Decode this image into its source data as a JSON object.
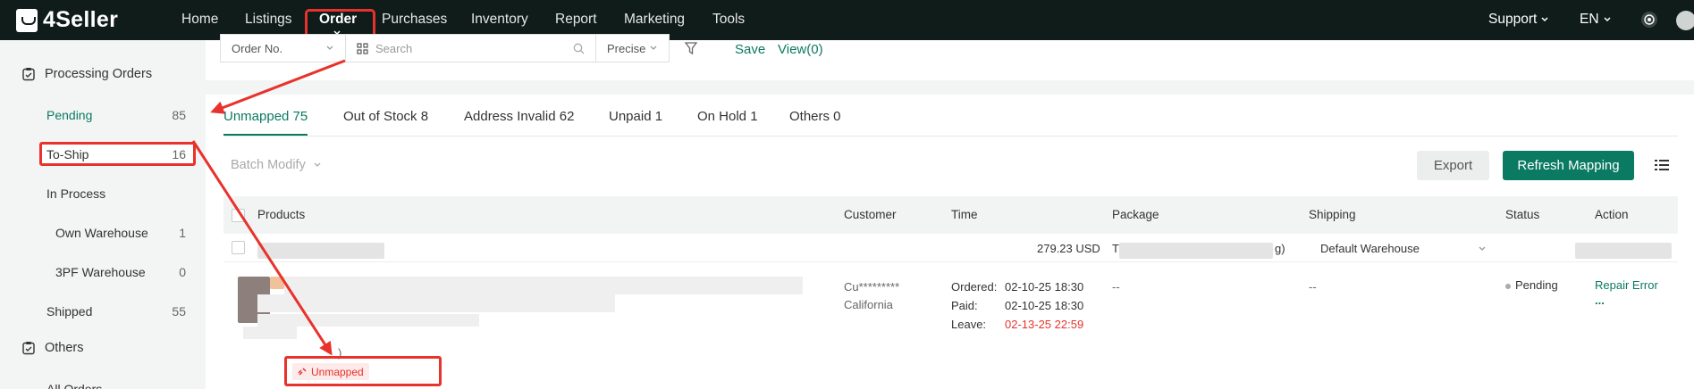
{
  "brand": {
    "name": "4Seller"
  },
  "nav": {
    "items": [
      "Home",
      "Listings",
      "Order",
      "Purchases",
      "Inventory",
      "Report",
      "Marketing",
      "Tools"
    ],
    "support": "Support",
    "language": "EN"
  },
  "sidebar": {
    "processing_orders": "Processing Orders",
    "pending": {
      "label": "Pending",
      "count": "85"
    },
    "to_ship": {
      "label": "To-Ship",
      "count": "16"
    },
    "in_process": "In Process",
    "own_warehouse": {
      "label": "Own Warehouse",
      "count": "1"
    },
    "pf_warehouse": {
      "label": "3PF Warehouse",
      "count": "0"
    },
    "shipped": {
      "label": "Shipped",
      "count": "55"
    },
    "others": "Others",
    "all_orders": "All Orders"
  },
  "search": {
    "field_select": "Order No.",
    "placeholder": "Search",
    "mode_select": "Precise",
    "save": "Save",
    "view": "View(0)"
  },
  "tabs": [
    "Unmapped 75",
    "Out of Stock 8",
    "Address Invalid 62",
    "Unpaid 1",
    "On Hold 1",
    "Others 0"
  ],
  "actions": {
    "batch_modify": "Batch Modify",
    "export": "Export",
    "refresh_mapping": "Refresh Mapping"
  },
  "table": {
    "headers": [
      "Products",
      "Customer",
      "Time",
      "Package",
      "Shipping",
      "Status",
      "Action"
    ],
    "subrow": {
      "amount": "279.23 USD",
      "package_prefix": "T",
      "package_suffix": "g)",
      "warehouse": "Default Warehouse"
    },
    "row": {
      "customer_name": "Cu*********",
      "customer_region": "California",
      "ordered_label": "Ordered:",
      "ordered_value": "02-10-25 18:30",
      "paid_label": "Paid:",
      "paid_value": "02-10-25 18:30",
      "leave_label": "Leave:",
      "leave_value": "02-13-25 22:59",
      "package": "--",
      "shipping": "--",
      "status": "Pending",
      "action": "Repair Error",
      "more": "...",
      "product_tail": ")",
      "tag": "Unmapped"
    }
  },
  "colors": {
    "brand_green": "#0b7a62",
    "highlight_red": "#e8322b",
    "topbar": "#0f1c1a"
  }
}
